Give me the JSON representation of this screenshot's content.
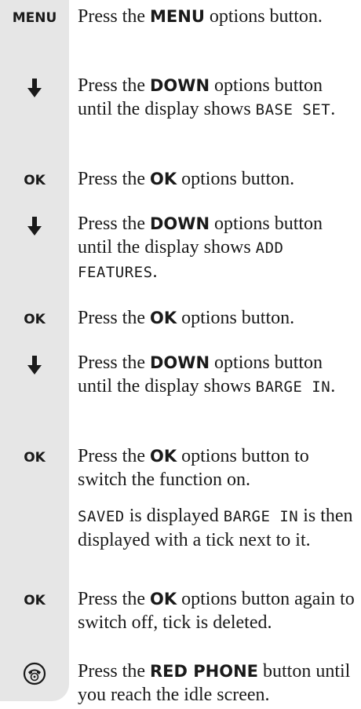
{
  "steps": [
    {
      "key_label": "MENU",
      "pre": "Press the ",
      "bold": "MENU",
      "post": " options button."
    },
    {
      "key_icon": "down-arrow-icon",
      "pre": "Press the ",
      "bold": "DOWN",
      "post": " options button until the display shows ",
      "lcd": "BASE SET",
      "end": "."
    },
    {
      "key_label": "OK",
      "pre": "Press the ",
      "bold": "OK",
      "post": " options button."
    },
    {
      "key_icon": "down-arrow-icon",
      "pre": "Press the ",
      "bold": "DOWN",
      "post": " options button until the display shows ",
      "lcd": "ADD FEATURES",
      "end": "."
    },
    {
      "key_label": "OK",
      "pre": "Press the ",
      "bold": "OK",
      "post": " options button."
    },
    {
      "key_icon": "down-arrow-icon",
      "pre": "Press the ",
      "bold": "DOWN",
      "post": " options button until the display shows ",
      "lcd": "BARGE IN",
      "end": "."
    },
    {
      "key_label": "OK",
      "pre": "Press the ",
      "bold": "OK",
      "post": " options button to switch the function on."
    },
    {
      "lcd1": "SAVED",
      "mid": " is displayed ",
      "lcd2": "BARGE IN",
      "post": " is then displayed with a tick next to it."
    },
    {
      "key_label": "OK",
      "pre": "Press the ",
      "bold": "OK",
      "post": " options button again to switch off, tick is deleted."
    },
    {
      "key_icon": "red-phone-icon",
      "pre": "Press the ",
      "bold": "RED PHONE",
      "post": " button until you reach the idle screen."
    }
  ]
}
